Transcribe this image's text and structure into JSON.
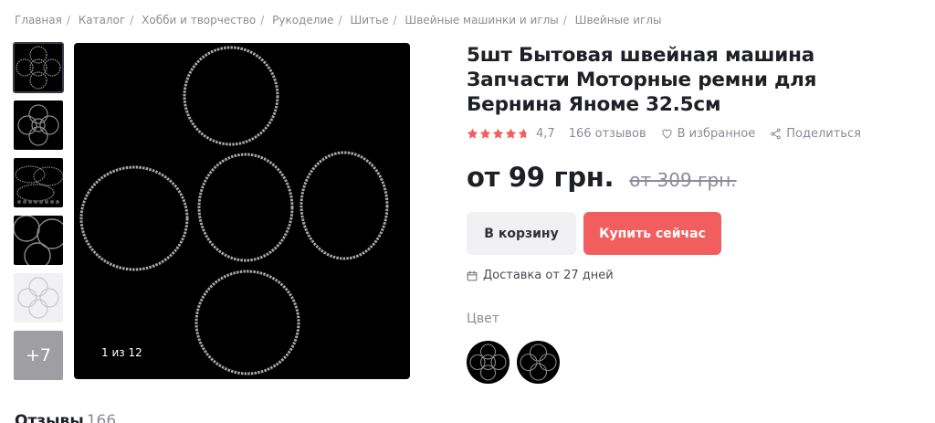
{
  "breadcrumbs": [
    "Главная",
    "Каталог",
    "Хобби и творчество",
    "Рукоделие",
    "Шитье",
    "Швейные машинки и иглы",
    "Швейные иглы"
  ],
  "gallery": {
    "more_label": "+7",
    "counter": "1 из 12"
  },
  "product": {
    "title": "5шт Бытовая швейная машина Запчасти Моторные ремни для Бернина Яноме 32.5см",
    "rating": "4,7",
    "stars": 4.7,
    "reviews": "166 отзывов",
    "favorite": "В избранное",
    "share": "Поделиться",
    "price": "от 99 грн.",
    "old_price": "от 309 грн."
  },
  "actions": {
    "cart": "В корзину",
    "buy": "Купить сейчас"
  },
  "delivery": "Доставка от 27 дней",
  "color": {
    "label": "Цвет"
  },
  "reviews_section": {
    "title": "Отзывы",
    "count": "166"
  },
  "colors": {
    "accent": "#f25e5e",
    "star": "#f25e5e",
    "muted": "#8b8b99"
  }
}
